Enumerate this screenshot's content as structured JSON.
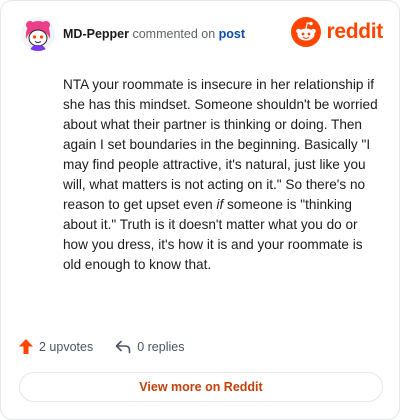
{
  "comment": {
    "username": "MD-Pepper",
    "action_text": "commented on",
    "post_link": "post",
    "body": {
      "part1": "NTA your roommate is insecure in her relationship if she has this mindset. Someone shouldn't be worried about what their partner is thinking or doing. Then again I set boundaries in the beginning. Basically \"I may find people attractive, it's natural, just like you will, what matters is not acting on it.\" So there's no reason to get upset even ",
      "emphasis": "if",
      "part2": " someone is \"thinking about it.\" Truth is it doesn't matter what you do or how you dress, it's how it is and your roommate is old enough to know that."
    },
    "upvotes_label": "2 upvotes",
    "replies_label": "0 replies"
  },
  "brand": {
    "name": "reddit",
    "color": "#ff4500"
  },
  "footer": {
    "view_more_label": "View more on Reddit"
  },
  "icons": {
    "avatar": "snoo-avatar-icon",
    "upvote": "upvote-arrow-icon",
    "reply": "reply-arrow-icon",
    "logo": "reddit-snoo-logo-icon"
  }
}
